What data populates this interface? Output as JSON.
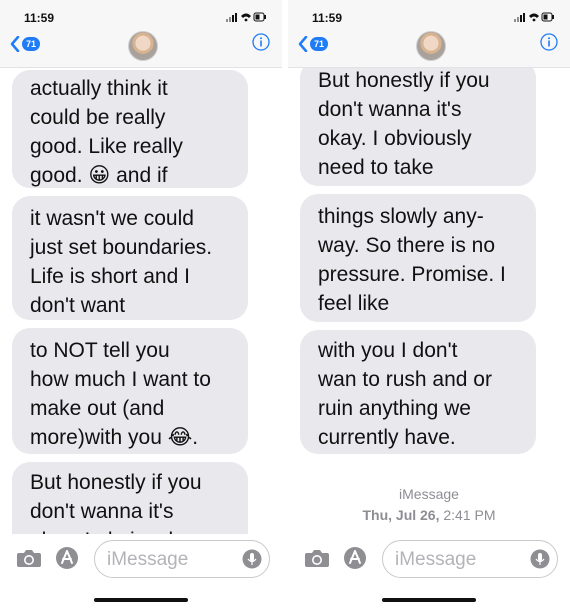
{
  "colors": {
    "accent": "#1f7cf7",
    "bubble_incoming": "#e8e8ed",
    "header_bg": "#f7f7f8",
    "meta_text": "#8d8d93"
  },
  "status": {
    "time": "11:59"
  },
  "header": {
    "back_badge": "71",
    "avatar_icon": "contact-avatar",
    "info_icon": "info-icon"
  },
  "left_thread": {
    "bubbles": [
      {
        "text": " actually think it\ncould be really\ngood. Like really\ngood. 😀 and if"
      },
      {
        "text": "it wasn't we could\njust set boundaries.\nLife is short and I\ndon't want"
      },
      {
        "text": " to NOT tell you\nhow much I want to\nmake out (and\nmore)with you 😂."
      },
      {
        "text": "But honestly if you\ndon't wanna it's\nokay. I obviously"
      }
    ]
  },
  "right_thread": {
    "bubbles": [
      {
        "text": "But honestly if you\ndon't wanna it's\nokay. I obviously\nneed to take"
      },
      {
        "text": "things slowly any-\nway. So there is no\npressure. Promise. I\nfeel like"
      },
      {
        "text": "with you I don't\nwan to rush and or\nruin anything we\ncurrently have."
      }
    ],
    "service_label": "iMessage",
    "date_label": "Thu, Jul 26,",
    "time_label": "2:41 PM"
  },
  "composer": {
    "placeholder": "iMessage",
    "camera_icon": "camera-icon",
    "apps_icon": "app-store-icon",
    "mic_icon": "microphone-icon"
  }
}
